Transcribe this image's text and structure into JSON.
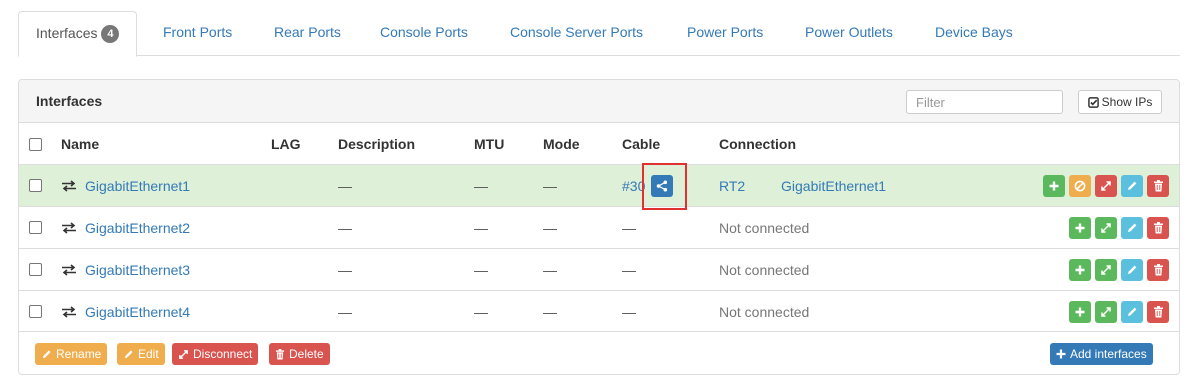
{
  "tabs": [
    {
      "label": "Interfaces",
      "badge": "4",
      "active": true
    },
    {
      "label": "Front Ports"
    },
    {
      "label": "Rear Ports"
    },
    {
      "label": "Console Ports"
    },
    {
      "label": "Console Server Ports"
    },
    {
      "label": "Power Ports"
    },
    {
      "label": "Power Outlets"
    },
    {
      "label": "Device Bays"
    }
  ],
  "panel": {
    "title": "Interfaces",
    "filter_placeholder": "Filter",
    "show_ips_label": "Show IPs"
  },
  "table": {
    "columns": [
      "Name",
      "LAG",
      "Description",
      "MTU",
      "Mode",
      "Cable",
      "Connection"
    ],
    "rows": [
      {
        "name": "GigabitEthernet1",
        "lag": "",
        "description": "—",
        "mtu": "—",
        "mode": "—",
        "cable": "#30",
        "connection_device": "RT2",
        "connection_interface": "GigabitEthernet1"
      },
      {
        "name": "GigabitEthernet2",
        "lag": "",
        "description": "—",
        "mtu": "—",
        "mode": "—",
        "cable": "—",
        "connection": "Not connected"
      },
      {
        "name": "GigabitEthernet3",
        "lag": "",
        "description": "—",
        "mtu": "—",
        "mode": "—",
        "cable": "—",
        "connection": "Not connected"
      },
      {
        "name": "GigabitEthernet4",
        "lag": "",
        "description": "—",
        "mtu": "—",
        "mode": "—",
        "cable": "—",
        "connection": "Not connected"
      }
    ]
  },
  "footer": {
    "rename_label": "Rename",
    "edit_label": "Edit",
    "disconnect_label": "Disconnect",
    "delete_label": "Delete",
    "add_label": "Add interfaces"
  },
  "icons": {
    "row_type": "swap-arrows-icon",
    "trace": "share-icon",
    "add": "plus-icon",
    "disable": "ban-icon",
    "connect": "resize-icon",
    "edit": "pencil-icon",
    "delete": "trash-icon",
    "checkbox": "check-square-icon"
  },
  "colors": {
    "link": "#337ab7",
    "connected_row": "#dff0d8",
    "success": "#5cb85c",
    "warning": "#f0ad4e",
    "danger": "#d9534f",
    "info": "#5bc0de",
    "primary": "#337ab7",
    "highlight": "#e03030"
  }
}
